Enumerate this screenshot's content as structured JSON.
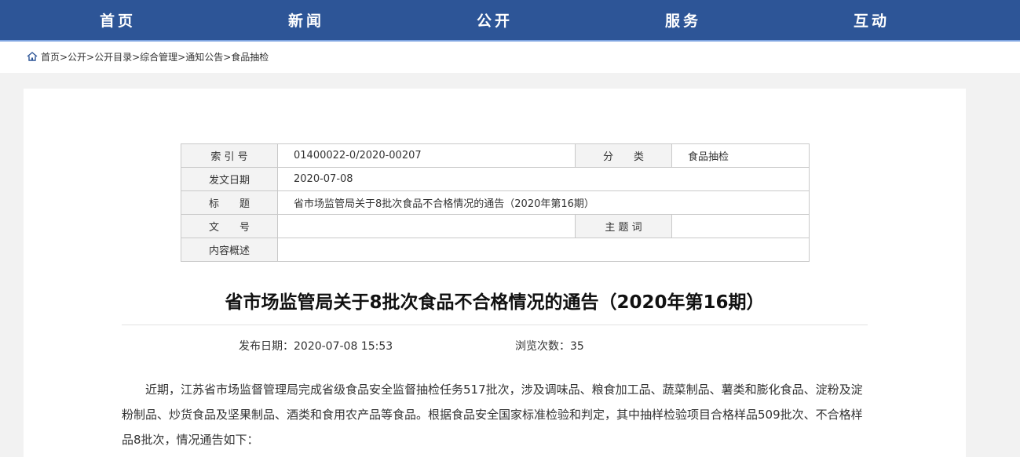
{
  "nav": [
    "首页",
    "新闻",
    "公开",
    "服务",
    "互动"
  ],
  "breadcrumb": "首页>公开>公开目录>综合管理>通知公告>食品抽检",
  "meta": {
    "index_label": "索 引 号",
    "index_value": "01400022-0/2020-00207",
    "category_label": "分　　类",
    "category_value": "食品抽检",
    "date_label": "发文日期",
    "date_value": "2020-07-08",
    "title_label": "标　　题",
    "title_value": "省市场监管局关于8批次食品不合格情况的通告（2020年第16期）",
    "docno_label": "文　　号",
    "docno_value": "",
    "keyword_label": "主 题 词",
    "keyword_value": "",
    "summary_label": "内容概述",
    "summary_value": ""
  },
  "article": {
    "title": "省市场监管局关于8批次食品不合格情况的通告（2020年第16期）",
    "publish_date": "发布日期：2020-07-08 15:53",
    "views": "浏览次数：35",
    "paragraph": "近期，江苏省市场监督管理局完成省级食品安全监督抽检任务517批次，涉及调味品、粮食加工品、蔬菜制品、薯类和膨化食品、淀粉及淀粉制品、炒货食品及坚果制品、酒类和食用农产品等食品。根据食品安全国家标准检验和判定，其中抽样检验项目合格样品509批次、不合格样品8批次，情况通告如下："
  },
  "colors": {
    "nav_bg": "#2d5597",
    "page_bg": "#f2f2f2"
  }
}
